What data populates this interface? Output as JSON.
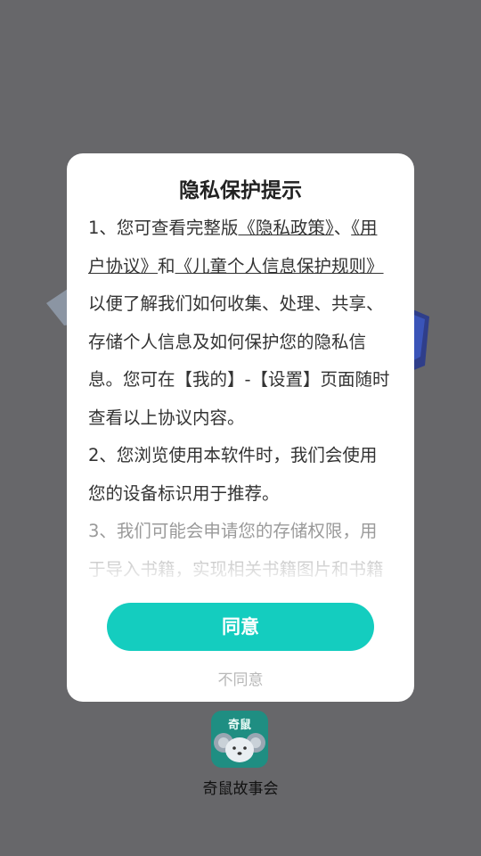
{
  "dialog": {
    "title": "隐私保护提示",
    "para1": {
      "t1": "1、您可查看完整版",
      "link_privacy": "《隐私政策》",
      "t2": "、",
      "link_user": "《用户协议》",
      "t3": "和",
      "link_child": "《儿童个人信息保护规则》",
      "t4": "以便了解我们如何收集、处理、共享、存储个人信息及如何保护您的隐私信息。您可在【我的】-【设置】页面随时查看以上协议内容。"
    },
    "para2": " 2、您浏览使用本软件时，我们会使用您的设备标识用于推荐。",
    "para3": " 3、我们可能会申请您的存储权限，用于导入书籍，实现相关书籍图片和书籍",
    "agree_label": "同意",
    "disagree_label": "不同意"
  },
  "app": {
    "name": "奇鼠故事会",
    "icon_text": "奇鼠",
    "icon_name": "mouse-logo-icon"
  },
  "colors": {
    "overlay": "#67676a",
    "accent": "#14cdbf",
    "icon_bg": "#1f8e82"
  }
}
